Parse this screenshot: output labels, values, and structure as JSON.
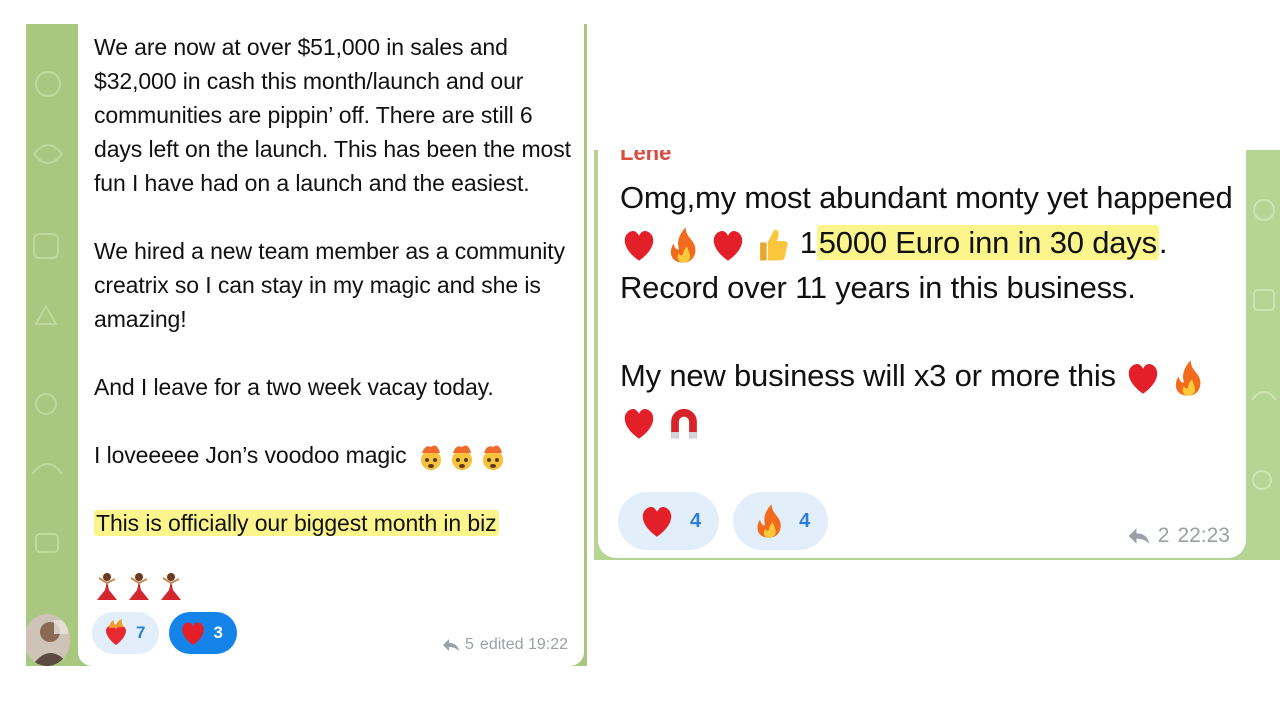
{
  "left_message": {
    "paragraphs": [
      "We are now at over $51,000 in sales and $32,000 in cash this month/launch and our communities are pippin’ off. There are still 6 days left on the launch. This has been the most fun I have had on a launch and the easiest.",
      "We hired a new team member as a community creatrix so I can stay in my magic and she is amazing!",
      "And I leave for a two week vacay today.",
      "I loveeeee Jon’s voodoo magic"
    ],
    "highlight_line": "This is officially our biggest month in biz",
    "reactions": [
      {
        "icon": "heart-on-fire-icon",
        "count": "7"
      },
      {
        "icon": "red-heart-icon",
        "count": "3"
      }
    ],
    "replies": "5",
    "timestamp": "edited 19:22"
  },
  "right_message": {
    "sender": "Lene",
    "text_part1": "Omg,my most abundant monty yet happened",
    "text_digit": "1",
    "text_highlight": "5000 Euro inn in 30 days",
    "text_part2": ". Record over 11 years in this business.",
    "text_para2": "My new business will  x3 or more this",
    "reactions": [
      {
        "icon": "red-heart-icon",
        "count": "4"
      },
      {
        "icon": "fire-icon",
        "count": "4"
      }
    ],
    "replies": "2",
    "timestamp": "22:23"
  },
  "colors": {
    "wallpaper_green": "#a9c77f",
    "highlight_yellow": "#fbf58c",
    "reaction_blue": "#2b7fd9",
    "sender_red": "#d94c3e"
  }
}
